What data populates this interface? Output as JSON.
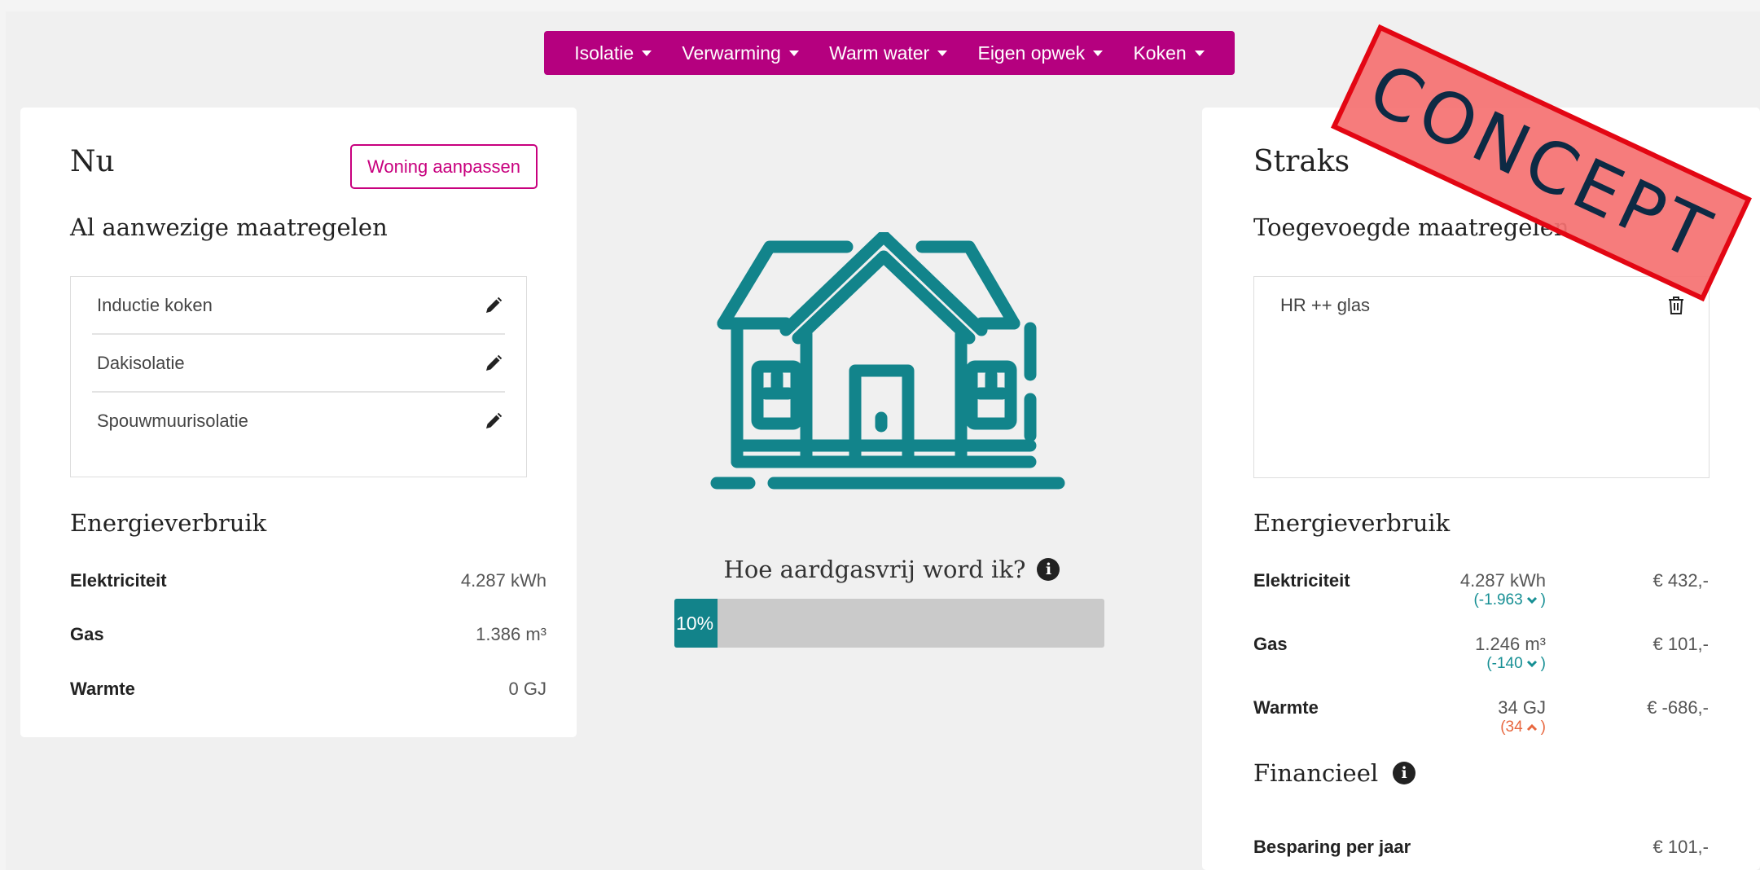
{
  "nav": {
    "items": [
      {
        "label": "Isolatie"
      },
      {
        "label": "Verwarming"
      },
      {
        "label": "Warm water"
      },
      {
        "label": "Eigen opwek"
      },
      {
        "label": "Koken"
      }
    ]
  },
  "left": {
    "title": "Nu",
    "edit_button": "Woning aanpassen",
    "measures_heading": "Al aanwezige maatregelen",
    "measures": [
      {
        "label": "Inductie koken"
      },
      {
        "label": "Dakisolatie"
      },
      {
        "label": "Spouwmuurisolatie"
      }
    ],
    "energy_heading": "Energieverbruik",
    "energy": [
      {
        "label": "Elektriciteit",
        "value": "4.287 kWh"
      },
      {
        "label": "Gas",
        "value": "1.386 m³"
      },
      {
        "label": "Warmte",
        "value": "0 GJ"
      }
    ]
  },
  "center": {
    "question": "Hoe aardgasvrij word ik?",
    "info_glyph": "i",
    "progress_percent": 10,
    "progress_label": "10%",
    "house_icon": "house-icon",
    "colors": {
      "accent": "#12838a",
      "nav": "#b5007f",
      "button": "#c8007e"
    }
  },
  "right": {
    "title": "Straks",
    "measures_heading": "Toegevoegde maatregelen",
    "measures": [
      {
        "label": "HR ++ glas"
      }
    ],
    "energy_heading": "Energieverbruik",
    "energy": [
      {
        "label": "Elektriciteit",
        "value": "4.287 kWh",
        "delta": "(-1.963",
        "direction": "down",
        "cost": "€ 432,-"
      },
      {
        "label": "Gas",
        "value": "1.246 m³",
        "delta": "(-140",
        "direction": "down",
        "cost": "€ 101,-"
      },
      {
        "label": "Warmte",
        "value": "34 GJ",
        "delta": "(34",
        "direction": "up",
        "cost": "€ -686,-"
      }
    ],
    "financial_heading": "Financieel",
    "info_glyph": "i",
    "savings_label": "Besparing per jaar",
    "savings_value": "€ 101,-"
  },
  "stamp": {
    "text": "CONCEPT"
  }
}
